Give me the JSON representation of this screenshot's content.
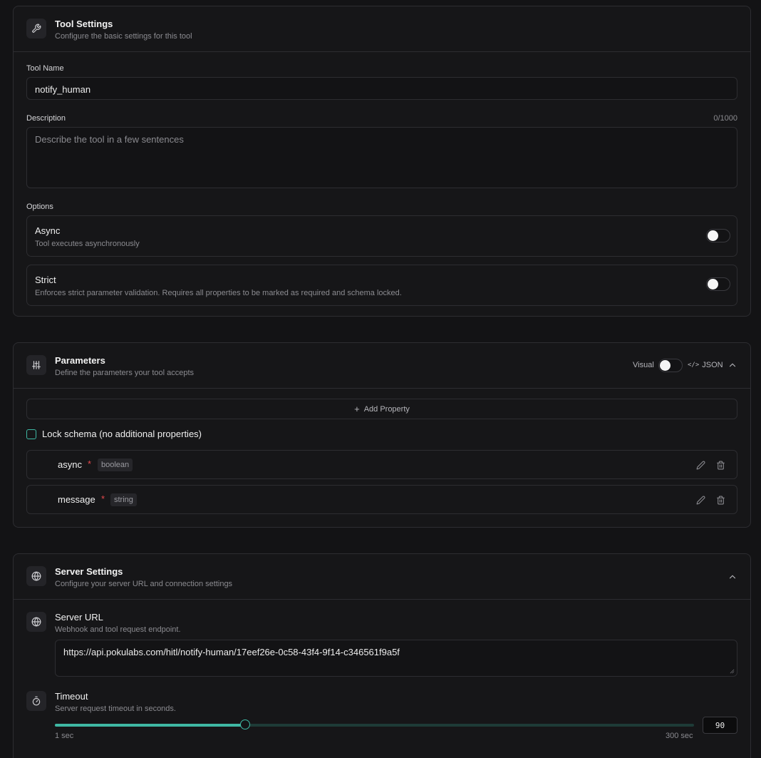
{
  "tool_settings": {
    "title": "Tool Settings",
    "subtitle": "Configure the basic settings for this tool",
    "icon": "wrench-icon",
    "tool_name_label": "Tool Name",
    "tool_name_value": "notify_human",
    "description_label": "Description",
    "description_counter": "0/1000",
    "description_placeholder": "Describe the tool in a few sentences",
    "options_label": "Options",
    "options": [
      {
        "title": "Async",
        "description": "Tool executes asynchronously",
        "enabled": false
      },
      {
        "title": "Strict",
        "description": "Enforces strict parameter validation. Requires all properties to be marked as required and schema locked.",
        "enabled": false
      }
    ]
  },
  "parameters": {
    "title": "Parameters",
    "subtitle": "Define the parameters your tool accepts",
    "icon": "sliders-icon",
    "mode_visual_label": "Visual",
    "mode_json_label": "JSON",
    "mode_is_json": false,
    "add_property_label": "Add Property",
    "lock_schema_label": "Lock schema (no additional properties)",
    "lock_schema_checked": false,
    "properties": [
      {
        "name": "async",
        "required_mark": "*",
        "type": "boolean"
      },
      {
        "name": "message",
        "required_mark": "*",
        "type": "string"
      }
    ]
  },
  "server_settings": {
    "title": "Server Settings",
    "subtitle": "Configure your server URL and connection settings",
    "icon": "globe-icon",
    "server_url_title": "Server URL",
    "server_url_subtitle": "Webhook and tool request endpoint.",
    "server_url_value": "https://api.pokulabs.com/hitl/notify-human/17eef26e-0c58-43f4-9f14-c346561f9a5f",
    "timeout_title": "Timeout",
    "timeout_subtitle": "Server request timeout in seconds.",
    "timeout_value": "90",
    "timeout_min": 1,
    "timeout_max": 300,
    "timeout_min_label": "1 sec",
    "timeout_max_label": "300 sec"
  },
  "colors": {
    "accent": "#3fb8a4",
    "required": "#e5484d",
    "background": "#131315",
    "card": "#161618",
    "border": "#2d2d31"
  }
}
